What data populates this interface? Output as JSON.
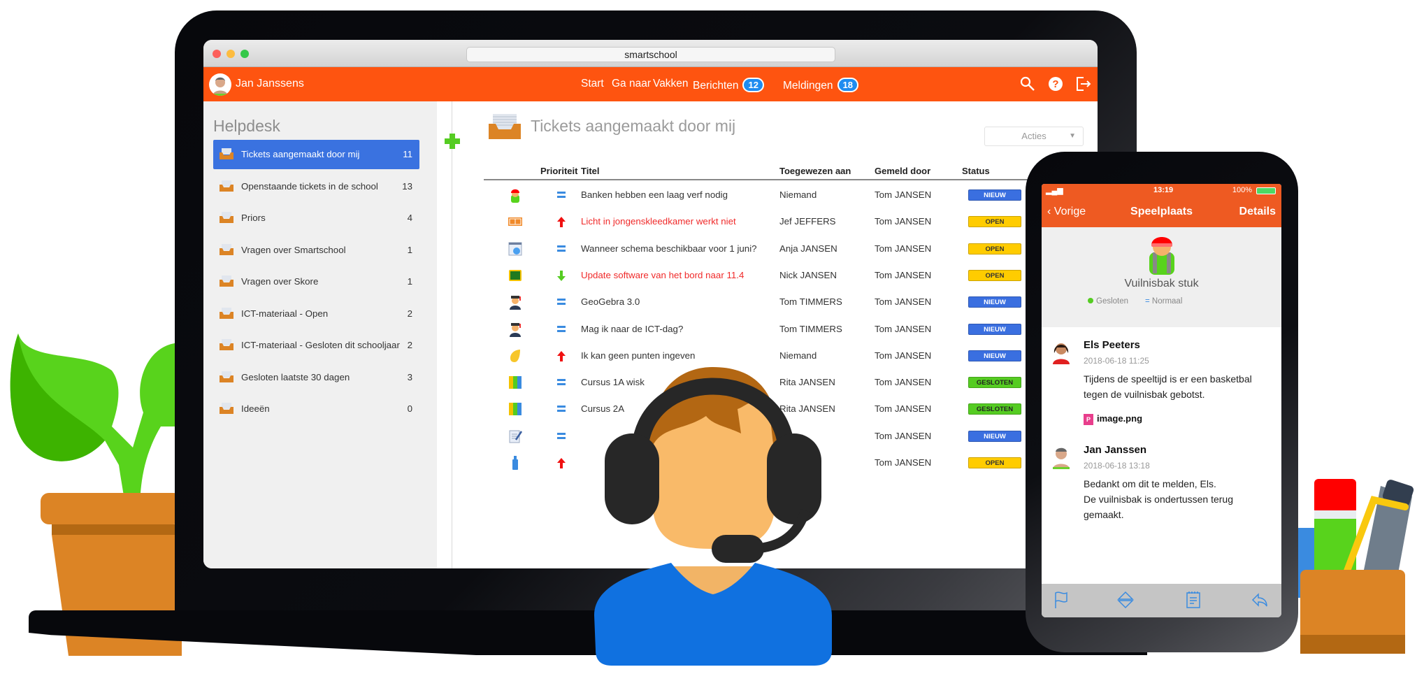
{
  "browser": {
    "address": "smartschool"
  },
  "header": {
    "user_name": "Jan Janssens",
    "nav": [
      {
        "label": "Start"
      },
      {
        "label": "Ga naar"
      },
      {
        "label": "Vakken"
      },
      {
        "label": "Berichten",
        "badge": "12"
      },
      {
        "label": "Meldingen",
        "badge": "18"
      }
    ],
    "icons": [
      "search-icon",
      "help-icon",
      "logout-icon"
    ]
  },
  "sidebar": {
    "title": "Helpdesk",
    "items": [
      {
        "label": "Tickets aangemaakt door mij",
        "count": "11",
        "active": true
      },
      {
        "label": "Openstaande tickets in de school",
        "count": "13"
      },
      {
        "label": "Priors",
        "count": "4"
      },
      {
        "label": "Vragen over Smartschool",
        "count": "1"
      },
      {
        "label": "Vragen over Skore",
        "count": "1"
      },
      {
        "label": "ICT-materiaal - Open",
        "count": "2"
      },
      {
        "label": "ICT-materiaal - Gesloten dit schooljaar",
        "count": "2"
      },
      {
        "label": "Gesloten laatste 30 dagen",
        "count": "3"
      },
      {
        "label": "Ideeën",
        "count": "0"
      }
    ]
  },
  "main": {
    "title": "Tickets aangemaakt door mij",
    "actions_label": "Acties",
    "columns": [
      "Prioriteit",
      "Titel",
      "Toegewezen aan",
      "Gemeld door",
      "Status"
    ],
    "rows": [
      {
        "icon": "student-icon",
        "priority": "normal",
        "title": "Banken hebben een laag verf nodig",
        "assigned": "Niemand",
        "reporter": "Tom JANSEN",
        "status": "NIEUW",
        "highlight": false
      },
      {
        "icon": "court-icon",
        "priority": "high",
        "title": "Licht in jongenskleedkamer werkt niet",
        "assigned": "Jef JEFFERS",
        "reporter": "Tom JANSEN",
        "status": "OPEN",
        "highlight": true
      },
      {
        "icon": "schedule-icon",
        "priority": "normal",
        "title": "Wanneer schema beschikbaar voor 1 juni?",
        "assigned": "Anja JANSEN",
        "reporter": "Tom JANSEN",
        "status": "OPEN",
        "highlight": false
      },
      {
        "icon": "blackboard-icon",
        "priority": "low",
        "title": "Update software van het bord naar 11.4",
        "assigned": "Nick JANSEN",
        "reporter": "Tom JANSEN",
        "status": "OPEN",
        "highlight": true
      },
      {
        "icon": "graduate-icon",
        "priority": "normal",
        "title": "GeoGebra 3.0",
        "assigned": "Tom TIMMERS",
        "reporter": "Tom JANSEN",
        "status": "NIEUW",
        "highlight": false
      },
      {
        "icon": "graduate-icon",
        "priority": "normal",
        "title": "Mag ik naar de ICT-dag?",
        "assigned": "Tom TIMMERS",
        "reporter": "Tom JANSEN",
        "status": "NIEUW",
        "highlight": false
      },
      {
        "icon": "shell-icon",
        "priority": "high",
        "title": "Ik kan geen punten ingeven",
        "assigned": "Niemand",
        "reporter": "Tom JANSEN",
        "status": "NIEUW",
        "highlight": false
      },
      {
        "icon": "binders-icon",
        "priority": "normal",
        "title": "Cursus 1A wisk",
        "assigned": "Rita JANSEN",
        "reporter": "Tom JANSEN",
        "status": "GESLOTEN",
        "highlight": false
      },
      {
        "icon": "binders-icon",
        "priority": "normal",
        "title": "Cursus 2A",
        "assigned": "Rita JANSEN",
        "reporter": "Tom JANSEN",
        "status": "GESLOTEN",
        "highlight": false
      },
      {
        "icon": "notepad-icon",
        "priority": "normal",
        "title": "",
        "assigned": "",
        "reporter": "Tom JANSEN",
        "status": "NIEUW",
        "highlight": false
      },
      {
        "icon": "glue-icon",
        "priority": "high",
        "title": "",
        "assigned": "",
        "reporter": "Tom JANSEN",
        "status": "OPEN",
        "highlight": false
      }
    ]
  },
  "phone": {
    "status": {
      "time": "13:19",
      "battery": "100%"
    },
    "nav": {
      "back": "Vorige",
      "title": "Speelplaats",
      "right": "Details"
    },
    "ticket": {
      "title": "Vuilnisbak stuk",
      "status": "Gesloten",
      "priority": "Normaal"
    },
    "messages": [
      {
        "author": "Els Peeters",
        "time": "2018-06-18 11:25",
        "text": "Tijdens de speeltijd is er een basketbal tegen de vuilnisbak gebotst.",
        "attachment": "image.png"
      },
      {
        "author": "Jan Janssen",
        "time": "2018-06-18 13:18",
        "text": "Bedankt om dit te melden, Els.\nDe vuilnisbak is ondertussen terug gemaakt.",
        "attachment": null
      }
    ],
    "toolbar": [
      "flag-icon",
      "expand-collapse-icon",
      "notes-icon",
      "reply-icon"
    ]
  },
  "colors": {
    "brand_orange": "#fe5410",
    "active_blue": "#3a72e0",
    "badge_blue": "#1f8cf0",
    "status_new": "#3a6fe0",
    "status_open": "#ffcc00",
    "status_closed": "#55cc22",
    "priority_high": "#f02a2a"
  }
}
